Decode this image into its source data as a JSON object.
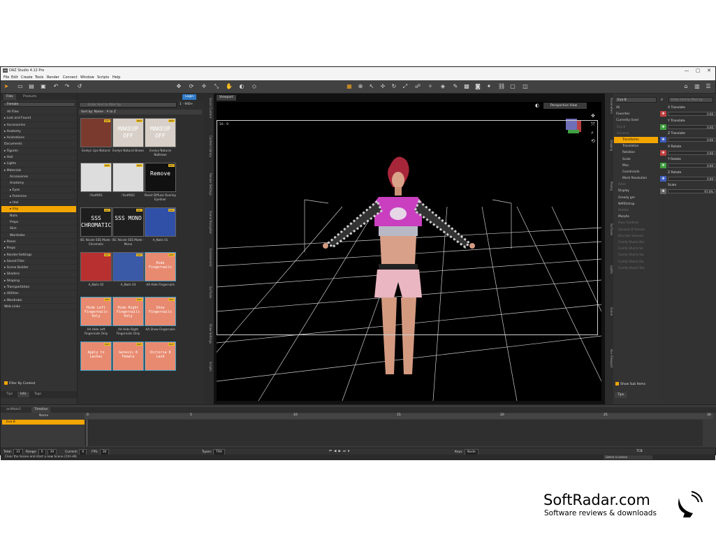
{
  "window": {
    "title": "DAZ Studio 4.12 Pro",
    "controls": [
      "—",
      "▢",
      "✕"
    ]
  },
  "menu": [
    "File",
    "Edit",
    "Create",
    "Tools",
    "Render",
    "Connect",
    "Window",
    "Scripts",
    "Help"
  ],
  "toolbar_icons": [
    "select-tool",
    "open",
    "save",
    "undo",
    "redo",
    "universal",
    "rotate",
    "translate",
    "scale",
    "active-pose",
    "node-weight",
    "frame",
    "orbit",
    "pan",
    "zoom",
    "render"
  ],
  "content": {
    "tabs": [
      "Files",
      "Products"
    ],
    "left_select": "Female",
    "category_header": "All Files",
    "tree": [
      {
        "label": "Lost and Found",
        "lvl": 0
      },
      {
        "label": "Accessories",
        "lvl": 0
      },
      {
        "label": "Anatomy",
        "lvl": 0
      },
      {
        "label": "Animations",
        "lvl": 0
      },
      {
        "label": "Documents",
        "lvl": 1
      },
      {
        "label": "Figures",
        "lvl": 0
      },
      {
        "label": "Hair",
        "lvl": 0
      },
      {
        "label": "Lights",
        "lvl": 0
      },
      {
        "label": "Materials",
        "lvl": 0
      },
      {
        "label": "Accessories",
        "lvl": 2
      },
      {
        "label": "Anatomy",
        "lvl": 2
      },
      {
        "label": "Eyes",
        "lvl": 3
      },
      {
        "label": "Feminine",
        "lvl": 3
      },
      {
        "label": "Hair",
        "lvl": 3
      },
      {
        "label": "Iray",
        "lvl": 3,
        "sel": true
      },
      {
        "label": "Nails",
        "lvl": 2
      },
      {
        "label": "Props",
        "lvl": 2
      },
      {
        "label": "Skin",
        "lvl": 2
      },
      {
        "label": "Wardrobe",
        "lvl": 2
      },
      {
        "label": "Poses",
        "lvl": 0
      },
      {
        "label": "Props",
        "lvl": 0
      },
      {
        "label": "Render-Settings",
        "lvl": 0
      },
      {
        "label": "Saved Files",
        "lvl": 0
      },
      {
        "label": "Scene Builder",
        "lvl": 0
      },
      {
        "label": "Shaders",
        "lvl": 0
      },
      {
        "label": "Shaping",
        "lvl": 0
      },
      {
        "label": "Transportation",
        "lvl": 0
      },
      {
        "label": "Utilities",
        "lvl": 0
      },
      {
        "label": "Wardrobe",
        "lvl": 0
      },
      {
        "label": "Web Links",
        "lvl": 1
      }
    ],
    "filter_label": "Filter By Context",
    "bottom_tabs": [
      "Tips",
      "Info",
      "Tags"
    ],
    "search_placeholder": "Enter text to filter by",
    "count": "1 - 940+",
    "sort_label": "Sort by: Name : A to Z",
    "badge": "IRAY",
    "items": [
      {
        "caption": "Evelyn Lips Natural",
        "big": ""
      },
      {
        "caption": "Evelyn Natural Brows",
        "big": "MAKEUP OFF"
      },
      {
        "caption": "Evelyn Natural NoBrows",
        "big": "MAKEUP OFF"
      },
      {
        "caption": "!Outfit01",
        "big": ""
      },
      {
        "caption": "!Outfit02",
        "big": ""
      },
      {
        "caption": "Reset Diffuse Overlay Eyeliner",
        "big": "Remove"
      },
      {
        "caption": "ISC Nicole SSS Mode - Chromatic",
        "big": "SSS CHROMATIC"
      },
      {
        "caption": "ISC Nicole SSS Mode - Mono",
        "big": "SSS MONO"
      },
      {
        "caption": "A_Nails 01",
        "big": ""
      },
      {
        "caption": "A_Nails 02",
        "big": ""
      },
      {
        "caption": "A_Nails 03",
        "big": ""
      },
      {
        "caption": "AA Hide Fingernails",
        "big": "Hide Fingernails"
      },
      {
        "caption": "AA Hide Left Fingernails Only",
        "big": "Hide Left Fingernails Only"
      },
      {
        "caption": "AA Hide Right Fingernails Only",
        "big": "Hide Right Fingernails Only"
      },
      {
        "caption": "AA Show Fingernails",
        "big": "Show Fingernails"
      },
      {
        "caption": "",
        "big": "Apply to Lashes"
      },
      {
        "caption": "",
        "big": "Genesis 8 Female"
      },
      {
        "caption": "",
        "big": "Victoria 8 Lash"
      }
    ]
  },
  "side_tabs_left": [
    "Smart Content",
    "Content Library",
    "Render Settings",
    "Scene Navigator",
    "Environment",
    "Surfaces",
    "Draw Settings",
    "Scripts"
  ],
  "viewport": {
    "tab": "Viewport",
    "view": "Perspective View",
    "ratio": "16 : 9"
  },
  "side_tabs_right": [
    "Parameters",
    "Shaping",
    "Posing",
    "Surfaces",
    "Lights",
    "Scene",
    "Aux Viewport"
  ],
  "scene": {
    "figure": "Eva 8",
    "filters": [
      "All",
      "Favorites",
      "Currently Used"
    ],
    "items": [
      {
        "label": "Eva 8",
        "dim": true
      },
      {
        "label": "General",
        "dim": true
      },
      {
        "label": "Transforms",
        "sel": true
      },
      {
        "label": "Translation"
      },
      {
        "label": "Rotation"
      },
      {
        "label": "Scale"
      },
      {
        "label": "Misc"
      },
      {
        "label": "Constraints"
      },
      {
        "label": "Mesh Resolution"
      },
      {
        "label": "Actor",
        "dim": true
      },
      {
        "label": "Display"
      },
      {
        "label": "Greedy gm"
      },
      {
        "label": "NARDstrap"
      },
      {
        "label": "Hidden",
        "dim": true
      },
      {
        "label": "Morphs"
      },
      {
        "label": "Pose Controls",
        "dim": true
      },
      {
        "label": "Genesis 8 Female",
        "dim": true
      },
      {
        "label": "Eva Hair Genesis",
        "dim": true
      },
      {
        "label": "Comfy Shorts Bel",
        "dim": true
      },
      {
        "label": "Comfy Shorts Sh",
        "dim": true
      },
      {
        "label": "Comfy Shorts Sw",
        "dim": true
      },
      {
        "label": "Comfy Shorts Da",
        "dim": true
      },
      {
        "label": "Comfy Shorts Tee",
        "dim": true
      }
    ],
    "show_sub": "Show Sub Items",
    "tips": "Tips"
  },
  "params": {
    "search": "Enter text to filter by",
    "rows": [
      {
        "label": "X Translate",
        "value": "0.00",
        "icon": "x-icon",
        "color": "#c04040"
      },
      {
        "label": "Y Translate",
        "value": "0.00",
        "icon": "y-icon",
        "color": "#40a040"
      },
      {
        "label": "Z Translate",
        "value": "0.00",
        "icon": "z-icon",
        "color": "#4060c0"
      },
      {
        "label": "X Rotate",
        "value": "0.00",
        "icon": "x-icon",
        "color": "#c04040"
      },
      {
        "label": "Y Rotate",
        "value": "0.00",
        "icon": "y-icon",
        "color": "#40a040"
      },
      {
        "label": "Z Rotate",
        "value": "0.00",
        "icon": "z-icon",
        "color": "#4060c0"
      },
      {
        "label": "Scale",
        "value": "97.0%",
        "icon": "s-icon",
        "color": "#666666"
      }
    ]
  },
  "timeline": {
    "tabs": [
      "aniMate2",
      "Timeline"
    ],
    "name_header": "Name",
    "row": "Eva 8",
    "ticks": [
      "0",
      "5",
      "10",
      "15",
      "20",
      "25",
      "30"
    ],
    "total_label": "Total:",
    "total": "31",
    "range_label": "Range:",
    "range_a": "0",
    "range_b": "30",
    "current_label": "Current:",
    "current": "0",
    "fps_label": "FPS:",
    "fps": "30",
    "types_label": "Types:",
    "types": "TRA",
    "keys_label": "Keys:",
    "keys": "Node",
    "tcb": "TCB"
  },
  "status": {
    "text": "Clear the Scene and start a new Scene (Ctrl+N)",
    "lesson": "Select a Lesson"
  },
  "watermark": {
    "name": "SoftRadar.com",
    "tag": "Software reviews & downloads"
  }
}
